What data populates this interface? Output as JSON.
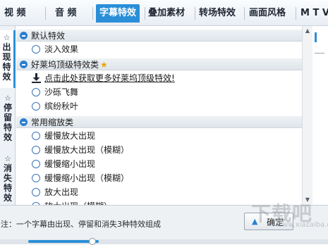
{
  "tabs": [
    {
      "label": "视 频"
    },
    {
      "label": "音 频"
    },
    {
      "label": "字幕特效"
    },
    {
      "label": "叠加素材"
    },
    {
      "label": "转场特效"
    },
    {
      "label": "画面风格"
    },
    {
      "label": "M T V"
    }
  ],
  "active_tab": "字幕特效",
  "sidebar": [
    {
      "label": "出现特效",
      "icon": "star-outline-icon"
    },
    {
      "label": "停留特效",
      "icon": "star-outline-icon"
    },
    {
      "label": "消失特效",
      "icon": "star-outline-icon"
    }
  ],
  "categories": {
    "default": {
      "label": "默认特效",
      "items": [
        "淡入效果"
      ]
    },
    "hollywood": {
      "label": "好莱坞顶级特效类",
      "link": "点击此处获取更多好莱坞顶级特效!",
      "items": [
        "沙砾飞舞",
        "缤纷秋叶"
      ]
    },
    "zoom": {
      "label": "常用缩放类",
      "items": [
        "缓慢放大出现",
        "缓慢放大出现（模糊）",
        "缓慢缩小出现",
        "缓慢缩小出现（模糊）",
        "放大出现",
        "放大出现（模糊）"
      ]
    }
  },
  "footer": {
    "note": "注：一个字幕由出现、停留和消失3种特效组成",
    "button_label": "确定"
  },
  "watermark": {
    "text": "下载吧",
    "sub": "www.xiazaiba.com"
  },
  "colors": {
    "accent": "#2a8fd8",
    "star": "#f0a400"
  }
}
